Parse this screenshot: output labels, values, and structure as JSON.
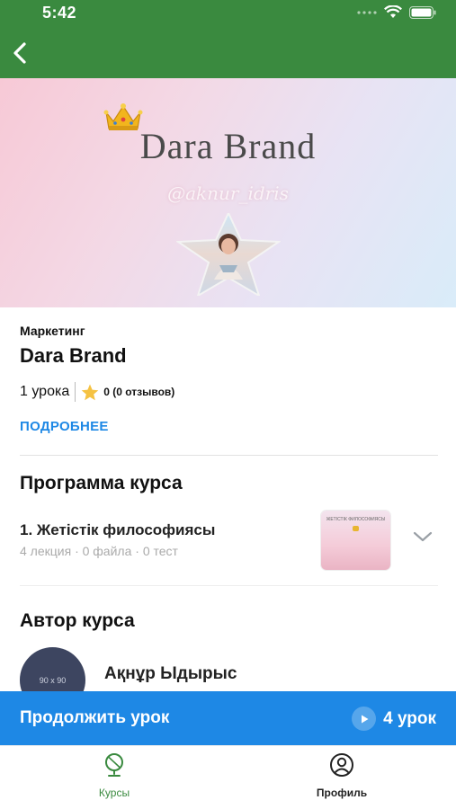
{
  "status": {
    "time": "5:42"
  },
  "header": {
    "back_icon": "chevron-left-icon"
  },
  "hero": {
    "title": "Dara Brand",
    "handle": "@aknur_idris",
    "crown_icon": "crown-icon"
  },
  "course": {
    "category": "Маркетинг",
    "title": "Dara Brand",
    "lessons_count": "1 урока",
    "rating": "0 (0 отзывов)",
    "more_label": "ПОДРОБНЕЕ"
  },
  "program": {
    "title": "Программа курса",
    "lessons": [
      {
        "title": "1. Жетістік философиясы",
        "meta": "4 лекция · 0 файла · 0 тест",
        "thumb_text": "ЖЕТІСТІК ФИЛОСОФИЯСЫ"
      }
    ]
  },
  "author": {
    "title": "Автор курса",
    "avatar_placeholder": "90 x 90",
    "name": "Ақнұр Ыдырыс"
  },
  "continue": {
    "label": "Продолжить урок",
    "lesson_label": "4 урок"
  },
  "tabs": [
    {
      "label": "Курсы",
      "icon": "globe-icon",
      "active": true
    },
    {
      "label": "Профиль",
      "icon": "profile-icon",
      "active": false
    }
  ],
  "colors": {
    "header_green": "#3a8a3f",
    "accent_blue": "#1e88e5",
    "star_gold": "#f5c242"
  }
}
